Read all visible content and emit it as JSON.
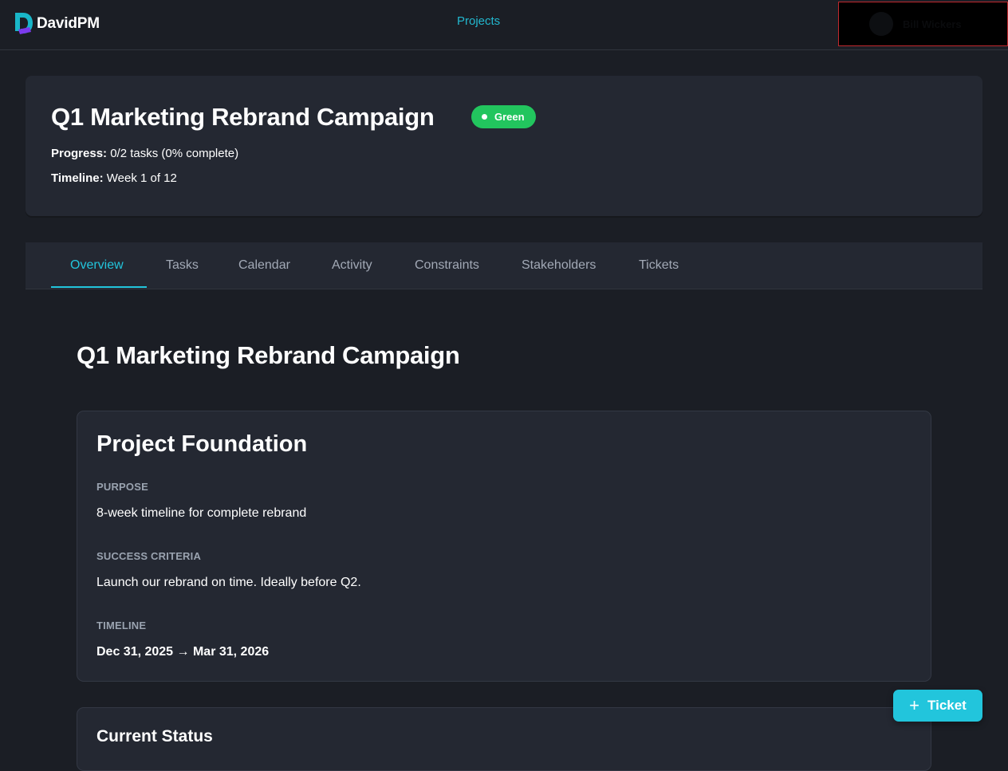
{
  "app": {
    "name": "DavidPM",
    "brand_colors": {
      "primary": "#22c5dc",
      "secondary": "#7c3aed",
      "logo": "#19b6c8"
    },
    "logo_icon": "d-logo-icon"
  },
  "topnav": {
    "projects_label": "Projects",
    "user_name": "Bill Wickers"
  },
  "project": {
    "title": "Q1 Marketing Rebrand Campaign",
    "status": "Green",
    "status_color": "#22c55e",
    "progress_label": "Progress:",
    "progress_value": "0/2 tasks (0% complete)",
    "timeline_label": "Timeline:",
    "timeline_value": "Week 1 of 12"
  },
  "tabs": [
    {
      "label": "Overview",
      "active": true
    },
    {
      "label": "Tasks"
    },
    {
      "label": "Calendar"
    },
    {
      "label": "Activity"
    },
    {
      "label": "Constraints"
    },
    {
      "label": "Stakeholders"
    },
    {
      "label": "Tickets"
    }
  ],
  "overview": {
    "title": "Q1 Marketing Rebrand Campaign",
    "foundation": {
      "heading": "Project Foundation",
      "purpose_label": "PURPOSE",
      "purpose_value": "8-week timeline for complete rebrand",
      "success_label": "SUCCESS CRITERIA",
      "success_value": "Launch our rebrand on time. Ideally before Q2.",
      "timeline_label": "TIMELINE",
      "timeline_value": "Dec 31, 2025 → Mar 31, 2026"
    },
    "current_status": {
      "heading": "Current Status"
    }
  },
  "fab": {
    "label": "Ticket",
    "icon": "plus-icon"
  }
}
